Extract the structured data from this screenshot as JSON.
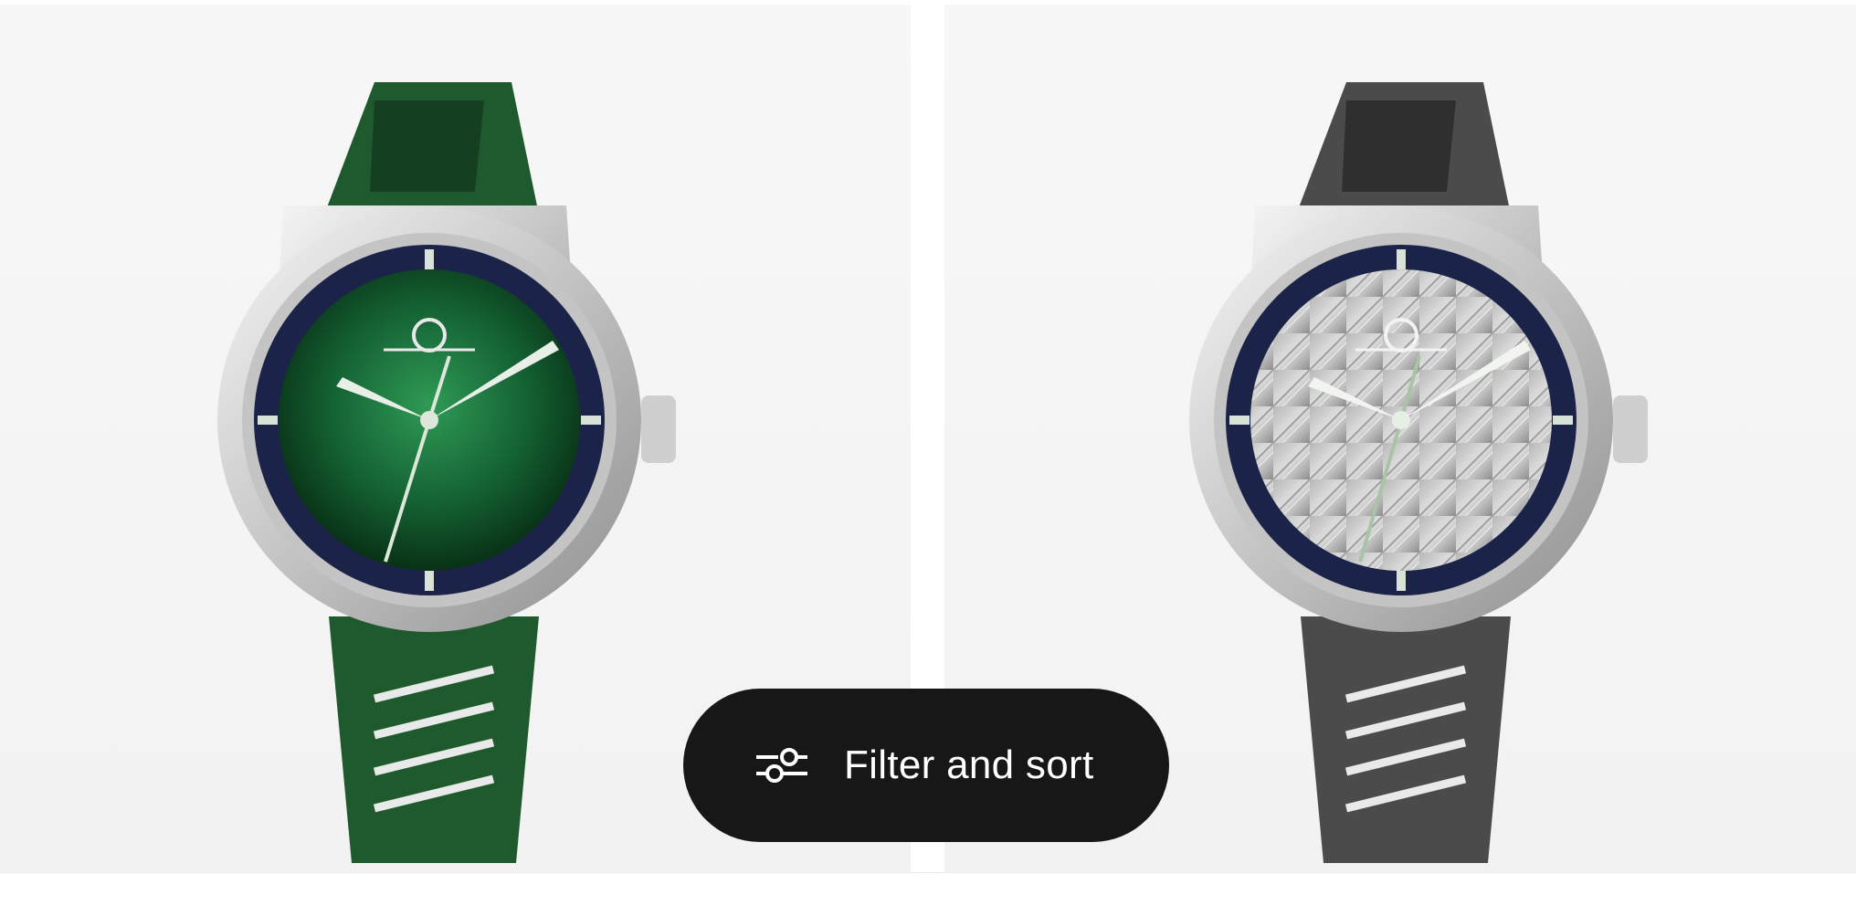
{
  "products": [
    {
      "name": "green-dial-watch",
      "strap_color": "#1f5a2e",
      "dial_style": "green-sunburst",
      "icon": "watch-image"
    },
    {
      "name": "meteorite-dial-watch",
      "strap_color": "#4b4b4b",
      "dial_style": "meteorite",
      "icon": "watch-image"
    }
  ],
  "filter": {
    "label": "Filter and sort",
    "icon": "sliders-icon"
  },
  "colors": {
    "button_bg": "#171717",
    "button_text": "#ffffff",
    "card_bg": "#f5f5f5"
  }
}
